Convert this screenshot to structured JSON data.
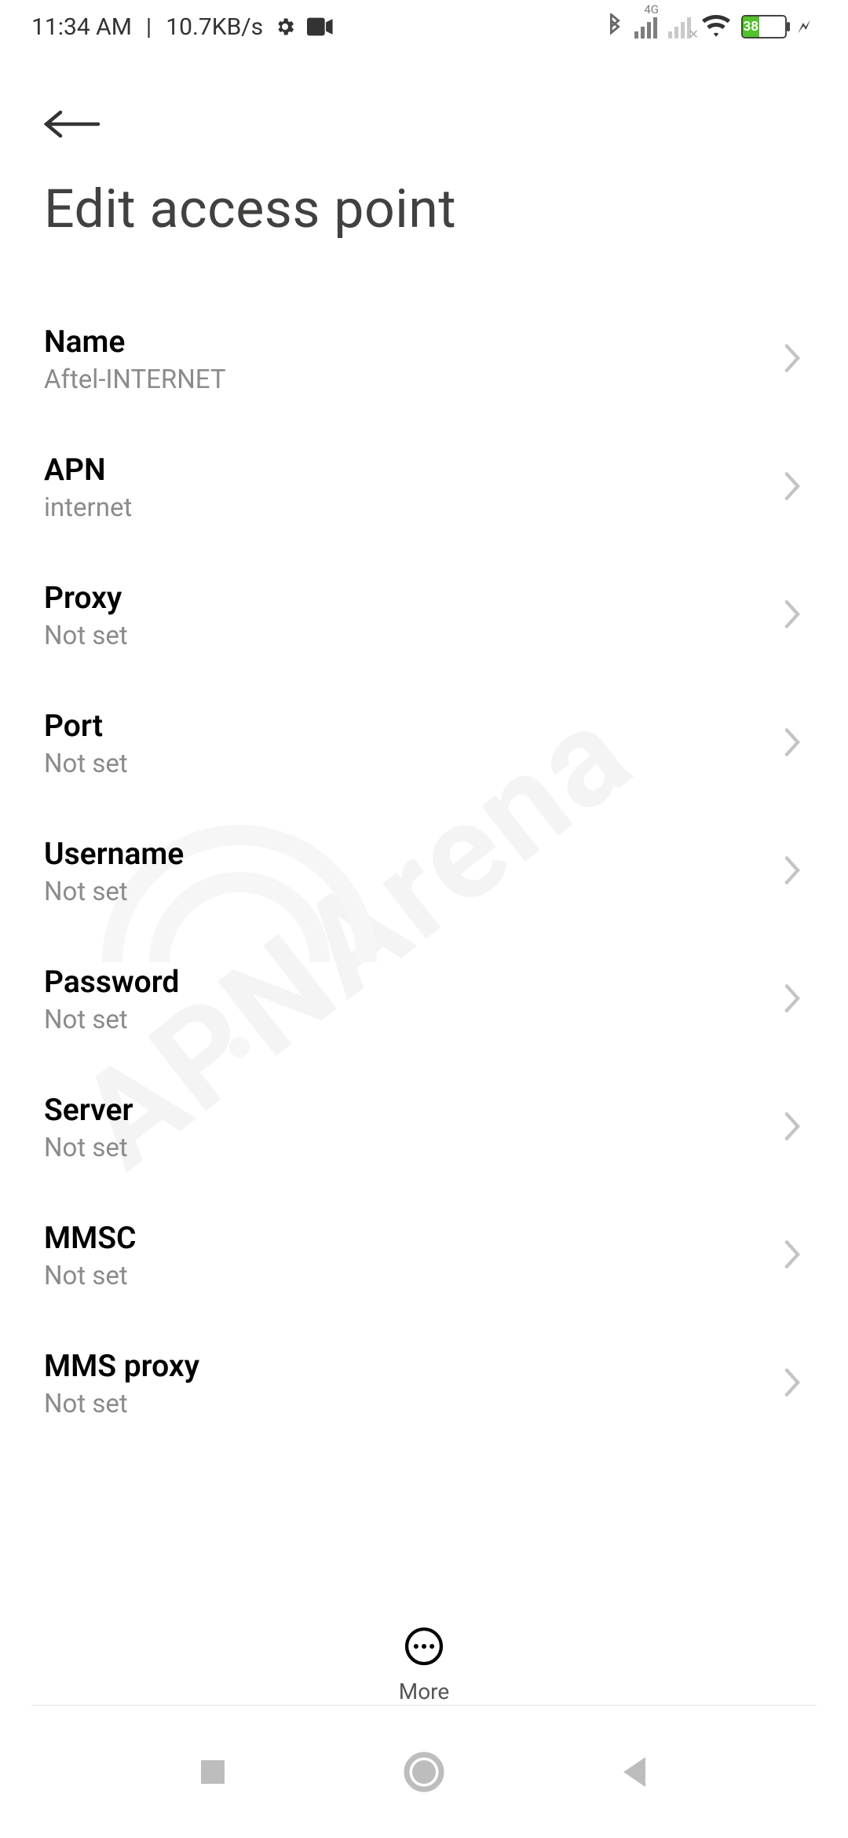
{
  "status": {
    "time": "11:34 AM",
    "speed": "10.7KB/s",
    "sig1_label": "4G",
    "battery_pct": "38"
  },
  "page_title": "Edit access point",
  "settings": [
    {
      "label": "Name",
      "value": "Aftel-INTERNET"
    },
    {
      "label": "APN",
      "value": "internet"
    },
    {
      "label": "Proxy",
      "value": "Not set"
    },
    {
      "label": "Port",
      "value": "Not set"
    },
    {
      "label": "Username",
      "value": "Not set"
    },
    {
      "label": "Password",
      "value": "Not set"
    },
    {
      "label": "Server",
      "value": "Not set"
    },
    {
      "label": "MMSC",
      "value": "Not set"
    },
    {
      "label": "MMS proxy",
      "value": "Not set"
    }
  ],
  "more_label": "More",
  "watermark": "APNArena",
  "colors": {
    "text_primary": "#000000",
    "text_secondary": "#8b8b8b",
    "title": "#40423f",
    "battery_fill": "#53c22b",
    "page_bg": "#ffffff"
  }
}
